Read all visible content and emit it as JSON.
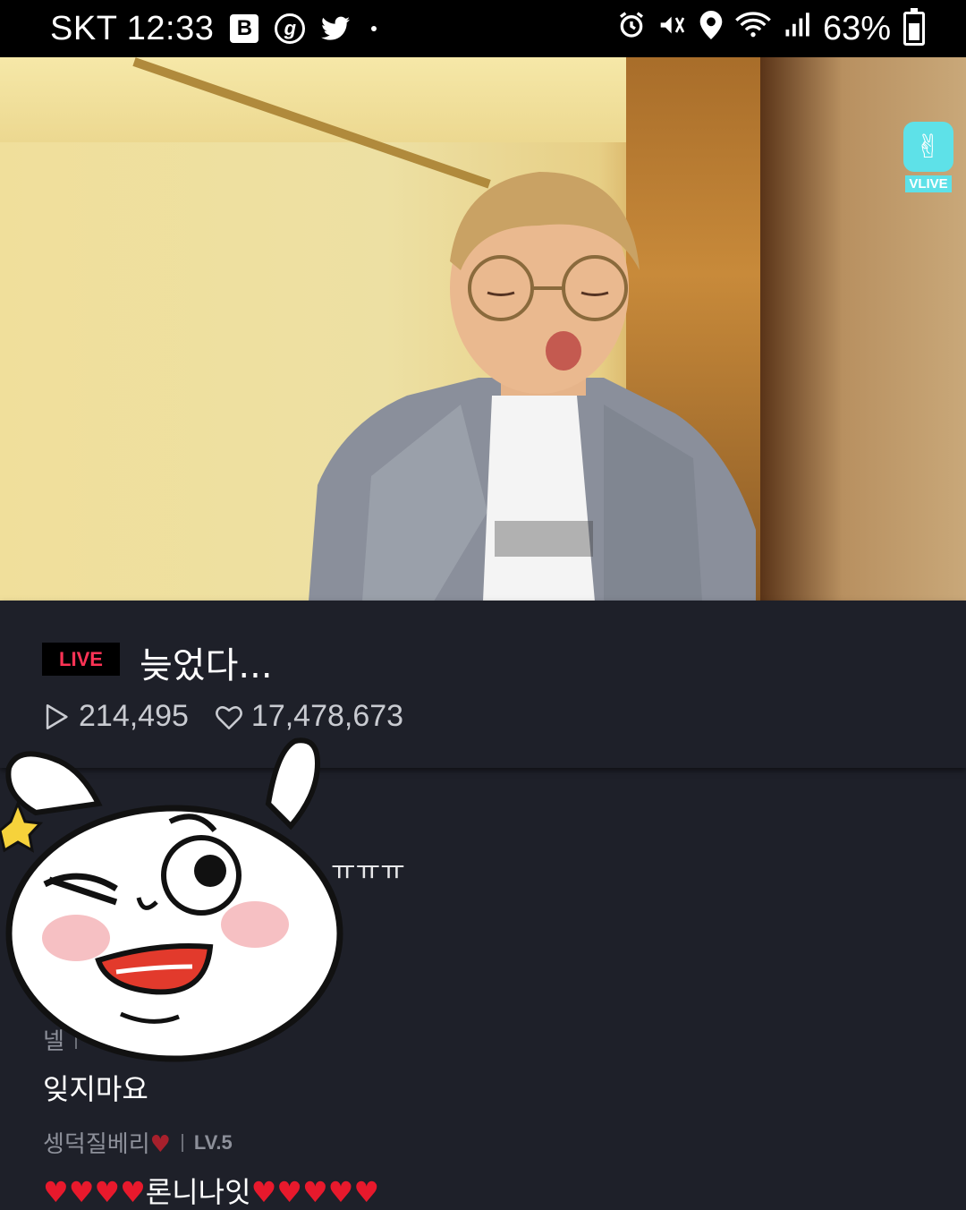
{
  "status_bar": {
    "carrier": "SKT",
    "time": "12:33",
    "app_icons": [
      "B",
      "g"
    ],
    "battery_percent": "63%"
  },
  "vlive": {
    "logo_label": "VLIVE"
  },
  "broadcast": {
    "live_label": "LIVE",
    "title": "늦었다...",
    "play_count": "214,495",
    "like_count": "17,478,673"
  },
  "chat": {
    "partial_text": "ㅠㅠㅠ",
    "messages": [
      {
        "user": "넬",
        "level": "",
        "text": "잊지마요"
      },
      {
        "user": "셍덕질베리♥",
        "level": "LV.5",
        "text": "♥♥♥♥론니나잇♥♥♥♥♥"
      }
    ]
  },
  "colors": {
    "background": "#1e2029",
    "live_red": "#ff3355",
    "vlive_cyan": "#5ee1e8"
  }
}
